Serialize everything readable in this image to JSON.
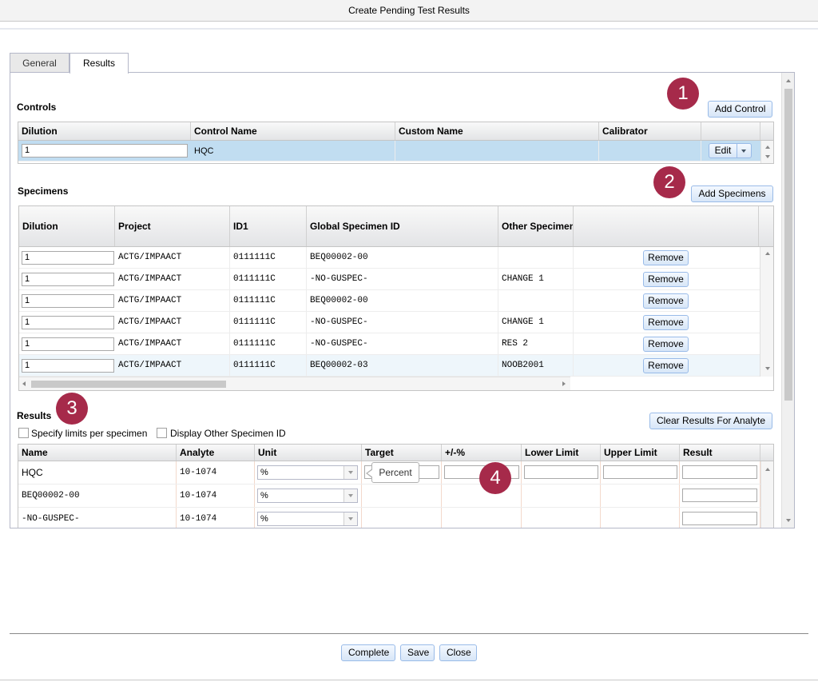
{
  "window": {
    "title": "Create Pending Test Results"
  },
  "tabs": [
    {
      "label": "General"
    },
    {
      "label": "Results"
    }
  ],
  "controls": {
    "title": "Controls",
    "add_button": "Add Control",
    "columns": [
      "Dilution",
      "Control Name",
      "Custom Name",
      "Calibrator"
    ],
    "row": {
      "dilution": "1",
      "control_name": "HQC",
      "custom_name": "",
      "calibrator": "",
      "edit_button": "Edit"
    }
  },
  "specimens": {
    "title": "Specimens",
    "add_button": "Add Specimens",
    "columns": [
      "Dilution",
      "Project",
      "ID1",
      "Global Specimen ID",
      "Other Specimen"
    ],
    "remove_label": "Remove",
    "rows": [
      {
        "dilution": "1",
        "project": "ACTG/IMPAACT",
        "id1": "0111111C",
        "gsid": "BEQ00002-00",
        "other": ""
      },
      {
        "dilution": "1",
        "project": "ACTG/IMPAACT",
        "id1": "0111111C",
        "gsid": "-NO-GUSPEC-",
        "other": "CHANGE 1"
      },
      {
        "dilution": "1",
        "project": "ACTG/IMPAACT",
        "id1": "0111111C",
        "gsid": "BEQ00002-00",
        "other": ""
      },
      {
        "dilution": "1",
        "project": "ACTG/IMPAACT",
        "id1": "0111111C",
        "gsid": "-NO-GUSPEC-",
        "other": "CHANGE 1"
      },
      {
        "dilution": "1",
        "project": "ACTG/IMPAACT",
        "id1": "0111111C",
        "gsid": "-NO-GUSPEC-",
        "other": "RES 2"
      },
      {
        "dilution": "1",
        "project": "ACTG/IMPAACT",
        "id1": "0111111C",
        "gsid": "BEQ00002-03",
        "other": "NOOB2001"
      }
    ]
  },
  "results": {
    "title": "Results",
    "clear_button": "Clear Results For Analyte",
    "specify_limits_label": "Specify limits per specimen",
    "display_other_label": "Display Other Specimen ID",
    "columns": [
      "Name",
      "Analyte",
      "Unit",
      "Target",
      "+/-%",
      "Lower Limit",
      "Upper Limit",
      "Result"
    ],
    "rows": [
      {
        "name": "HQC",
        "analyte": "10-1074",
        "unit": "%"
      },
      {
        "name": "BEQ00002-00",
        "analyte": "10-1074",
        "unit": "%"
      },
      {
        "name": "-NO-GUSPEC-",
        "analyte": "10-1074",
        "unit": "%"
      }
    ],
    "tooltip": "Percent"
  },
  "badges": [
    "1",
    "2",
    "3",
    "4"
  ],
  "footer": {
    "complete": "Complete",
    "save": "Save",
    "close": "Close"
  },
  "colors": {
    "badge": "#a62a4a",
    "button_border": "#99bbe8",
    "selected_row": "#c1ddf1"
  }
}
